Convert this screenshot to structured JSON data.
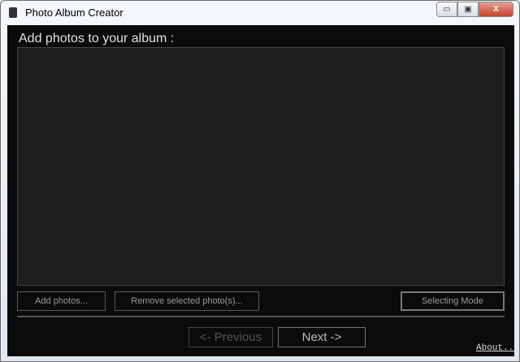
{
  "window": {
    "title": "Photo Album Creator",
    "minimize": "▭",
    "maximize": "▣",
    "close": "X"
  },
  "main": {
    "heading": "Add photos to your album :"
  },
  "buttons": {
    "add": "Add photos...",
    "remove": "Remove selected photo(s)...",
    "mode": "Selecting Mode",
    "previous": "<- Previous",
    "next": "Next ->"
  },
  "footer": {
    "about": "About..."
  }
}
